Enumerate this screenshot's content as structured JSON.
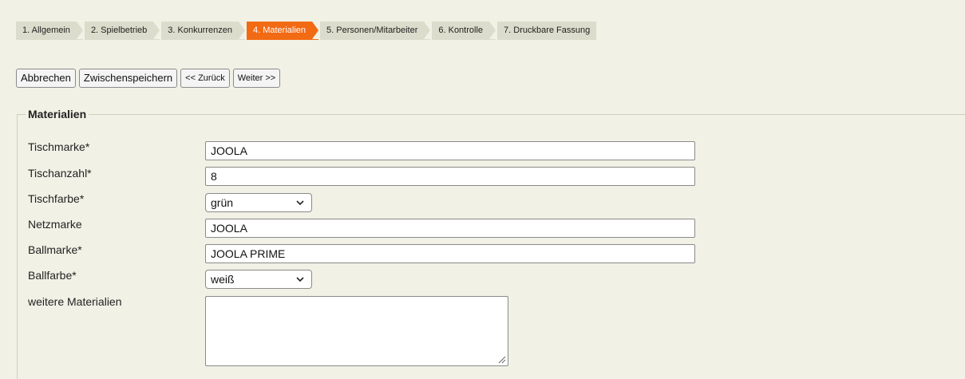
{
  "wizard": {
    "steps": [
      {
        "label": "1. Allgemein",
        "active": false
      },
      {
        "label": "2. Spielbetrieb",
        "active": false
      },
      {
        "label": "3. Konkurrenzen",
        "active": false
      },
      {
        "label": "4. Materialien",
        "active": true
      },
      {
        "label": "5. Personen/Mitarbeiter",
        "active": false
      },
      {
        "label": "6. Kontrolle",
        "active": false
      },
      {
        "label": "7. Druckbare Fassung",
        "active": false
      }
    ],
    "active_color": "#f26a13",
    "inactive_color": "#dcdccc"
  },
  "toolbar": {
    "cancel_label": "Abbrechen",
    "save_label": "Zwischenspeichern",
    "back_label": "<< Zurück",
    "next_label": "Weiter >>"
  },
  "form": {
    "legend": "Materialien",
    "tischmarke": {
      "label": "Tischmarke*",
      "value": "JOOLA"
    },
    "tischanzahl": {
      "label": "Tischanzahl*",
      "value": "8"
    },
    "tischfarbe": {
      "label": "Tischfarbe*",
      "selected": "grün"
    },
    "netzmarke": {
      "label": "Netzmarke",
      "value": "JOOLA"
    },
    "ballmarke": {
      "label": "Ballmarke*",
      "value": "JOOLA PRIME"
    },
    "ballfarbe": {
      "label": "Ballfarbe*",
      "selected": "weiß"
    },
    "weitere": {
      "label": "weitere Materialien",
      "value": ""
    }
  },
  "icons": {
    "select_arrow": "chevron-down-icon",
    "resize": "resize-grip-icon"
  }
}
